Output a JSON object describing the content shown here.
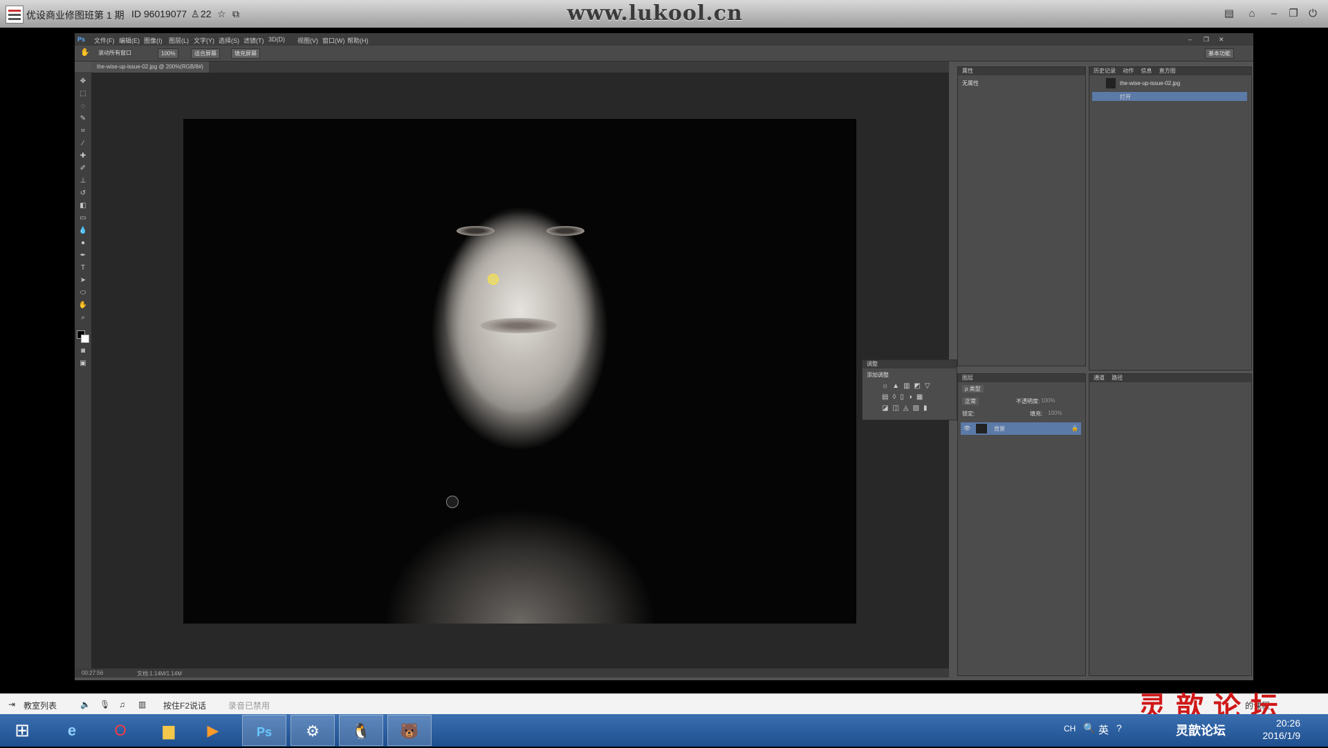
{
  "window": {
    "title": "优设商业修图班第 1 期",
    "id_text": "ID 96019077",
    "user_count": "22",
    "watermark": "www.lukool.cn"
  },
  "ps": {
    "logo": "Ps",
    "menu": [
      "文件(F)",
      "编辑(E)",
      "图像(I)",
      "图层(L)",
      "文字(Y)",
      "选择(S)",
      "滤镜(T)",
      "3D(D)",
      "视图(V)",
      "窗口(W)",
      "帮助(H)"
    ],
    "options": [
      "滚动所有窗口",
      "100%",
      "适合屏幕",
      "填充屏幕"
    ],
    "workspace": "基本功能",
    "doc_tab": "the-wise-up-issue-02.jpg @ 200%(RGB/8#)",
    "zoom_status": "00:27:56",
    "doc_status": "文档:1.14M/1.14M",
    "properties": {
      "tab": "属性",
      "body": "无属性"
    },
    "history": {
      "tabs": [
        "历史记录",
        "动作",
        "信息",
        "直方图"
      ],
      "items": [
        "the-wise-up-issue-02.jpg",
        "打开"
      ]
    },
    "adjustments": {
      "tab": "调整",
      "label": "添加调整"
    },
    "layers": {
      "tab": "图层",
      "kind": "ρ 类型",
      "blend": "正常",
      "opacity_label": "不透明度:",
      "opacity": "100%",
      "lock_label": "锁定:",
      "fill_label": "填充:",
      "fill": "100%",
      "layer_name": "背景"
    },
    "channels": {
      "tabs": [
        "通道",
        "路径"
      ]
    }
  },
  "bottombar": {
    "items": [
      "教室列表",
      "按住F2说话",
      "录音已禁用"
    ],
    "forum": "灵歆论坛",
    "my_courses": "的课程"
  },
  "taskbar": {
    "lang": "CH",
    "ime": "英",
    "time": "20:26",
    "date": "2016/1/9",
    "app_label": "灵歆论坛"
  },
  "colors": {
    "accent": "#5c7aa8",
    "forum_red": "#d01818"
  }
}
